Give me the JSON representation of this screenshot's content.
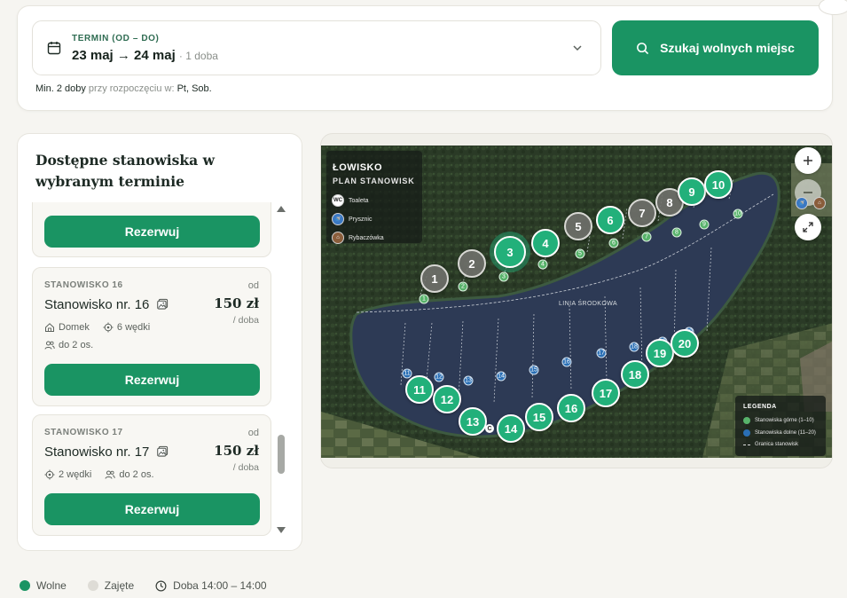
{
  "search": {
    "date_label": "TERMIN (OD – DO)",
    "date_value": "23 maj → 24 maj",
    "date_nights": "· 1 doba",
    "search_button": "Szukaj wolnych miejsc",
    "min_note_prefix": "Min. 2 doby",
    "min_note_mid": " przy rozpoczęciu w: ",
    "min_note_days": "Pt, Sob."
  },
  "panel": {
    "title": "Dostępne stanowiska w wybranym terminie",
    "reserve_label": "Rezerwuj",
    "stands": [
      {
        "code": "STANOWISKO 16",
        "from": "od",
        "name": "Stanowisko nr. 16",
        "price": "150 zł",
        "per": "/ doba",
        "features": [
          {
            "icon": "house-icon",
            "text": "Domek"
          },
          {
            "icon": "rods-icon",
            "text": "6 wędki"
          },
          {
            "icon": "people-icon",
            "text": "do 2 os."
          }
        ]
      },
      {
        "code": "STANOWISKO 17",
        "from": "od",
        "name": "Stanowisko nr. 17",
        "price": "150 zł",
        "per": "/ doba",
        "features": [
          {
            "icon": "rods-icon",
            "text": "2 wędki"
          },
          {
            "icon": "people-icon",
            "text": "do 2 os."
          }
        ]
      }
    ]
  },
  "map": {
    "title": "ŁOWISKO",
    "subtitle": "PLAN STANOWISK",
    "legend_items": [
      {
        "icon": "toilet-icon",
        "badge": "WC",
        "text": "Toaleta"
      },
      {
        "icon": "shower-icon",
        "badge": "🚿",
        "text": "Prysznic"
      },
      {
        "icon": "fisher-house-icon",
        "badge": "⌂",
        "text": "Rybaczówka"
      }
    ],
    "middle_line": "LINIA ŚRODKOWA",
    "legend2_title": "LEGENDA",
    "legend2_upper": "Stanowiska górne (1–10)",
    "legend2_lower": "Stanowiska dolne (11–20)",
    "legend2_border": "Granica stanowisk",
    "pins_upper": [
      {
        "n": "1",
        "status": "taken"
      },
      {
        "n": "2",
        "status": "taken"
      },
      {
        "n": "3",
        "status": "selected"
      },
      {
        "n": "4",
        "status": "free"
      },
      {
        "n": "5",
        "status": "taken"
      },
      {
        "n": "6",
        "status": "free"
      },
      {
        "n": "7",
        "status": "taken"
      },
      {
        "n": "8",
        "status": "taken"
      },
      {
        "n": "9",
        "status": "free"
      },
      {
        "n": "10",
        "status": "free"
      }
    ],
    "pins_lower": [
      {
        "n": "11",
        "status": "free"
      },
      {
        "n": "12",
        "status": "free"
      },
      {
        "n": "13",
        "status": "free"
      },
      {
        "n": "14",
        "status": "free"
      },
      {
        "n": "15",
        "status": "free"
      },
      {
        "n": "16",
        "status": "free"
      },
      {
        "n": "17",
        "status": "free"
      },
      {
        "n": "18",
        "status": "free"
      },
      {
        "n": "19",
        "status": "free"
      },
      {
        "n": "20",
        "status": "free"
      }
    ],
    "small_marker": "C"
  },
  "footer": {
    "free": "Wolne",
    "taken": "Zajęte",
    "checkin": "Doba 14:00 – 14:00"
  },
  "colors": {
    "accent": "#1a9463",
    "pin_free": "#22b07a",
    "pin_taken": "#6f706c",
    "lower_spot": "#2a6fb5",
    "upper_spot": "#58b36b"
  }
}
